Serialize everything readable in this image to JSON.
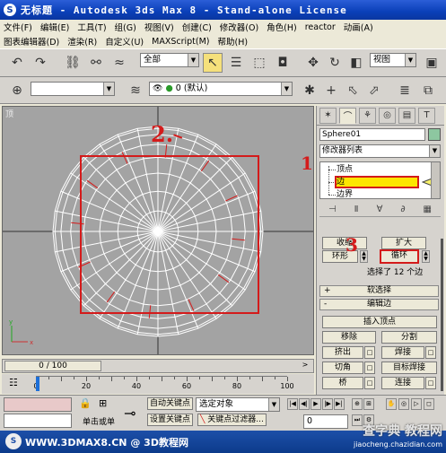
{
  "window": {
    "title": "无标题 - Autodesk 3ds Max 8 - Stand-alone License"
  },
  "menu": {
    "row1": [
      "文件(F)",
      "编辑(E)",
      "工具(T)",
      "组(G)",
      "视图(V)",
      "创建(C)",
      "修改器(O)",
      "角色(H)",
      "reactor",
      "动画(A)"
    ],
    "row2": [
      "图表编辑器(D)",
      "渲染(R)",
      "自定义(U)",
      "MAXScript(M)",
      "帮助(H)"
    ]
  },
  "toolbar": {
    "selection_filter": "全部",
    "coord_system": "视图",
    "layer_name": "0 (默认)"
  },
  "viewport": {
    "label": "顶"
  },
  "command_panel": {
    "object_name": "Sphere01",
    "modifier_list": "修改器列表",
    "stack_items": [
      "顶点",
      "边",
      "边界"
    ],
    "selected_stack_item": "边",
    "accent_color": "#fde600",
    "annotation_color": "#d41b1b",
    "object_color": "#8dc7a0",
    "buttons": {
      "shrink": "收缩",
      "grow": "扩大",
      "ring": "环形",
      "loop": "循环",
      "selection_info": "选择了 12 个边",
      "soft_selection": "软选择",
      "edit_edges": "编辑边",
      "insert_vertex": "插入顶点",
      "remove": "移除",
      "split": "分割",
      "extrude": "挤出",
      "weld": "焊接",
      "chamfer": "切角",
      "target_weld": "目标焊接",
      "bridge": "桥",
      "connect": "连接"
    },
    "soft_selection_toggle": "+",
    "edit_edges_toggle": "-"
  },
  "timeline": {
    "frame_display": "0 / 100",
    "ticks": [
      "0",
      "20",
      "40",
      "60",
      "80",
      "100"
    ]
  },
  "status": {
    "single_or": "单击或单",
    "auto_key": "自动关键点",
    "selected_object": "选定对象",
    "set_key": "设置关键点",
    "key_filters": "关键点过滤器...",
    "current_frame": "0"
  },
  "annotations": [
    "1",
    "2.",
    "3"
  ],
  "footer": {
    "site": "WWW.3DMAX8.CN @ 3D教程网",
    "watermark": "查字典 教程网",
    "watermark_url": "jiaocheng.chazidian.com"
  }
}
